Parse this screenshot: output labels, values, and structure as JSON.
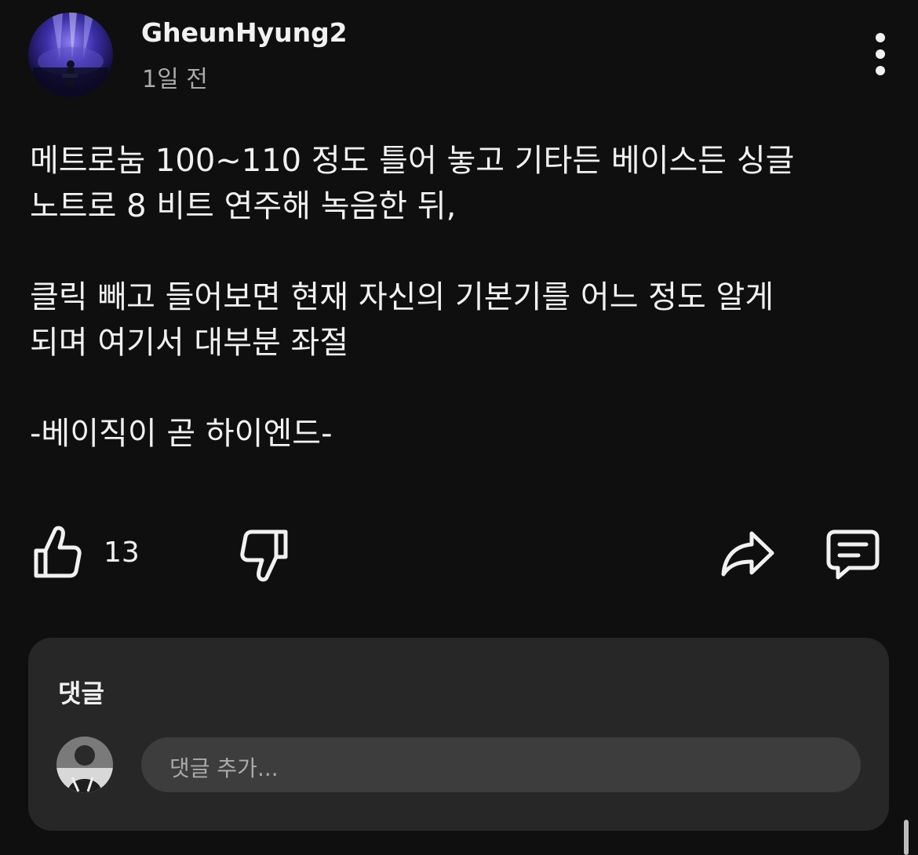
{
  "post": {
    "author": "GheunHyung2",
    "time": "1일 전",
    "body": [
      "메트로눔 100~110 정도 틀어 놓고 기타든 베이스든 싱글",
      "노트로 8 비트 연주해 녹음한 뒤,",
      "",
      "클릭 빼고 들어보면 현재 자신의 기본기를 어느 정도 알게",
      "되며 여기서 대부분 좌절",
      "",
      "-베이직이 곧 하이엔드-"
    ]
  },
  "actions": {
    "like_count": "13",
    "icons": [
      "thumbs-up-icon",
      "thumbs-down-icon",
      "share-icon",
      "comment-icon"
    ]
  },
  "comments": {
    "title": "댓글",
    "placeholder": "댓글 추가..."
  },
  "icons": {
    "more": "more-vertical-icon"
  },
  "colors": {
    "background": "#0f0f0f",
    "panel": "#272727",
    "input": "#3d3d3d",
    "text": "#f1f1f1",
    "secondary_text": "#aaaaaa"
  }
}
